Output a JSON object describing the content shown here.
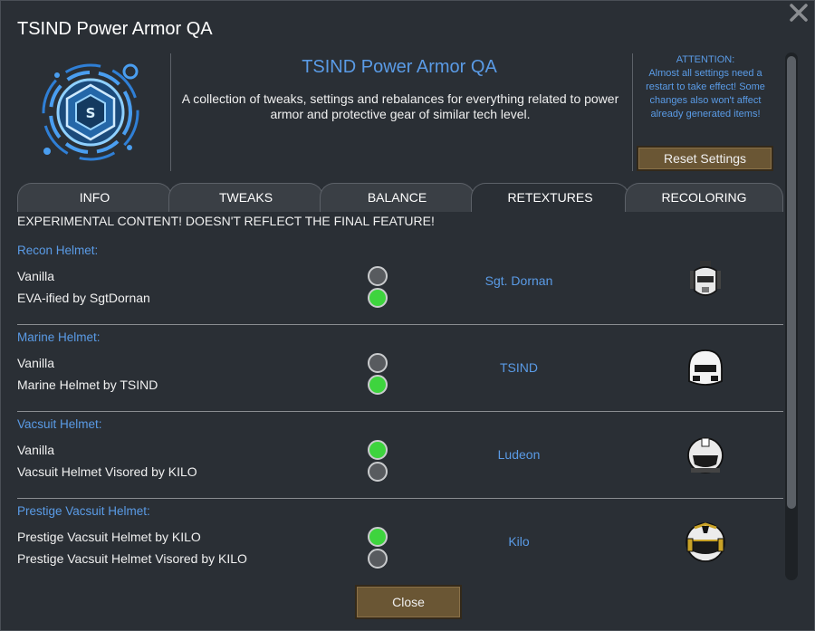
{
  "window": {
    "title": "TSIND Power Armor QA"
  },
  "header": {
    "mod_title": "TSIND Power Armor QA",
    "description": "A collection of tweaks, settings and rebalances for everything related to power armor and protective gear of similar tech level.",
    "attention_lines": [
      "ATTENTION:",
      "Almost all settings need a",
      "restart to take effect! Some",
      "changes also won't affect",
      "already generated items!"
    ],
    "reset_label": "Reset Settings"
  },
  "tabs": [
    {
      "label": "INFO",
      "active": false
    },
    {
      "label": "TWEAKS",
      "active": false
    },
    {
      "label": "BALANCE",
      "active": false
    },
    {
      "label": "RETEXTURES",
      "active": true
    },
    {
      "label": "RECOLORING",
      "active": false
    }
  ],
  "experimental_note": "EXPERIMENTAL CONTENT! DOESN'T REFLECT THE FINAL FEATURE!",
  "sections": [
    {
      "title": "Recon Helmet:",
      "author": "Sgt. Dornan",
      "options": [
        {
          "label": "Vanilla",
          "selected": false
        },
        {
          "label": "EVA-ified by SgtDornan",
          "selected": true
        }
      ]
    },
    {
      "title": "Marine Helmet:",
      "author": "TSIND",
      "options": [
        {
          "label": "Vanilla",
          "selected": false
        },
        {
          "label": "Marine Helmet by TSIND",
          "selected": true
        }
      ]
    },
    {
      "title": "Vacsuit Helmet:",
      "author": "Ludeon",
      "options": [
        {
          "label": "Vanilla",
          "selected": true
        },
        {
          "label": "Vacsuit Helmet Visored by KILO",
          "selected": false
        }
      ]
    },
    {
      "title": "Prestige Vacsuit Helmet:",
      "author": "Kilo",
      "options": [
        {
          "label": "Prestige Vacsuit Helmet by KILO",
          "selected": true
        },
        {
          "label": "Prestige Vacsuit Helmet Visored by KILO",
          "selected": false
        }
      ]
    }
  ],
  "footer": {
    "close_label": "Close"
  },
  "colors": {
    "accent_blue": "#5a9be6",
    "radio_on": "#3ed43e",
    "button_brown": "#6a5634"
  }
}
